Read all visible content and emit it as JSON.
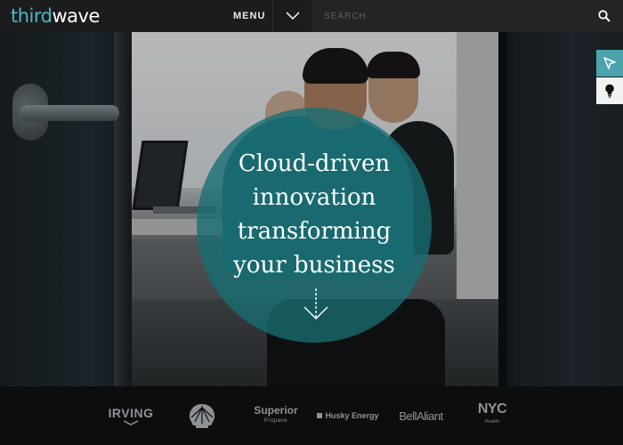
{
  "header": {
    "logo_part1": "third",
    "logo_part2": "wave",
    "menu_label": "MENU",
    "search_placeholder": "SEARCH"
  },
  "hero": {
    "headline_lines": [
      "Cloud-driven",
      "innovation",
      "transforming",
      "your business"
    ],
    "overlay_color": "#176e73"
  },
  "side_tools": {
    "items": [
      {
        "icon": "cursor-pointer-icon",
        "bg": "#4aa3ad"
      },
      {
        "icon": "lightbulb-icon",
        "bg": "#f2f2f2"
      }
    ]
  },
  "clients": {
    "irving": "IRVING",
    "shell_icon": "shell-logo-icon",
    "superior": "Superior",
    "superior_sub": "Propane",
    "husky": "Husky Energy",
    "bell": "BellAliant",
    "nyc": "NYC",
    "nyc_sub": "Health"
  },
  "colors": {
    "brand_teal": "#4fb6c4",
    "header_bg": "#1b1c1d",
    "footer_bg": "#0d0d0e",
    "logo_gray": "#8f9294"
  }
}
